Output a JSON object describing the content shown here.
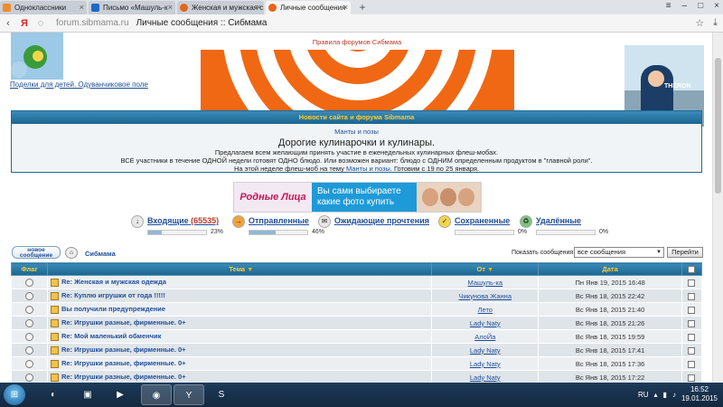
{
  "browser": {
    "tabs": [
      {
        "label": "Одноклассники",
        "color": "#f28c28"
      },
      {
        "label": "Письмо «Машуль-к",
        "color": "#1b6ac9"
      },
      {
        "label": "Женская и мужская с",
        "color": "#e8641b"
      },
      {
        "label": "Личные сообщения",
        "color": "#e8641b",
        "active": true
      }
    ],
    "address_host": "forum.sibmama.ru",
    "address_title": "Личные сообщения :: Сибмама"
  },
  "page": {
    "ad_left_caption": "Поделки для детей. Одуванчиковое поле",
    "rules_link": "Правила форумов Сибмама",
    "ad_right_brand": "THERON",
    "news": {
      "header": "Новости сайта и форума Sibmama",
      "sub_link": "Манты и позы",
      "title": "Дорогие кулинарочки и кулинары.",
      "line1": "Предлагаем всем желающим принять участие в еженедельных кулинарных флеш-мобах.",
      "line2": "ВСЕ участники в течение ОДНОЙ недели готовят ОДНО блюдо. Или возможен вариант: блюдо с ОДНИМ определенным продуктом в \"главной роли\".",
      "line3_pre": "На этой неделе флеш-моб на тему",
      "line3_link": "Манты и позы",
      "line3_post": ". Готовим с 19 по 25 января."
    },
    "small_banner": {
      "logo": "Родные Лица",
      "text": "Вы сами выбираете какие фото купить"
    },
    "folders": [
      {
        "name": "Входящие",
        "count": "(65535)",
        "percent_text": "23%",
        "fill": 0.23
      },
      {
        "name": "Отправленные",
        "count": "",
        "percent_text": "46%",
        "fill": 0.46
      },
      {
        "name": "Ожидающие прочтения",
        "count": "",
        "percent_text": "",
        "fill": 0
      },
      {
        "name": "Сохраненные",
        "count": "",
        "percent_text": "0%",
        "fill": 0
      },
      {
        "name": "Удалённые",
        "count": "",
        "percent_text": "0%",
        "fill": 0
      }
    ],
    "new_message_btn": "новое сообщение",
    "breadcrumb": "Сибмама",
    "show_label": "Показать сообщения:",
    "show_select": "все сообщения",
    "go_btn": "Перейти",
    "table": {
      "headers": {
        "flag": "Флаг",
        "subject": "Тема",
        "from": "От",
        "date": "Дата"
      },
      "rows": [
        {
          "subject": "Re: Женская и мужская одежда",
          "from": "Машуль-ка",
          "date": "Пн Янв 19, 2015 16:48"
        },
        {
          "subject": "Re: Куплю игрушки от года !!!!!",
          "from": "Чикунова Жанна",
          "date": "Вс Янв 18, 2015 22:42"
        },
        {
          "subject": "Вы получили предупреждение",
          "from": "Лето",
          "date": "Вс Янв 18, 2015 21:40"
        },
        {
          "subject": "Re: Игрушки разные, фирменные. 0+",
          "from": "Lady Naty",
          "date": "Вс Янв 18, 2015 21:26"
        },
        {
          "subject": "Re: Мой маленький обменчик",
          "from": "АлоЙа",
          "date": "Вс Янв 18, 2015 19:59"
        },
        {
          "subject": "Re: Игрушки разные, фирменные. 0+",
          "from": "Lady Naty",
          "date": "Вс Янв 18, 2015 17:41"
        },
        {
          "subject": "Re: Игрушки разные, фирменные. 0+",
          "from": "Lady Naty",
          "date": "Вс Янв 18, 2015 17:36"
        },
        {
          "subject": "Re: Игрушки разные, фирменные. 0+",
          "from": "Lady Naty",
          "date": "Вс Янв 18, 2015 17:22"
        }
      ]
    }
  },
  "taskbar": {
    "lang": "RU",
    "time": "16:52",
    "date": "19.01.2015"
  },
  "colors": {
    "link": "#1f4e99",
    "header_bar": "#1b6690",
    "header_text": "#ffcc33",
    "banner_orange": "#f06814"
  }
}
